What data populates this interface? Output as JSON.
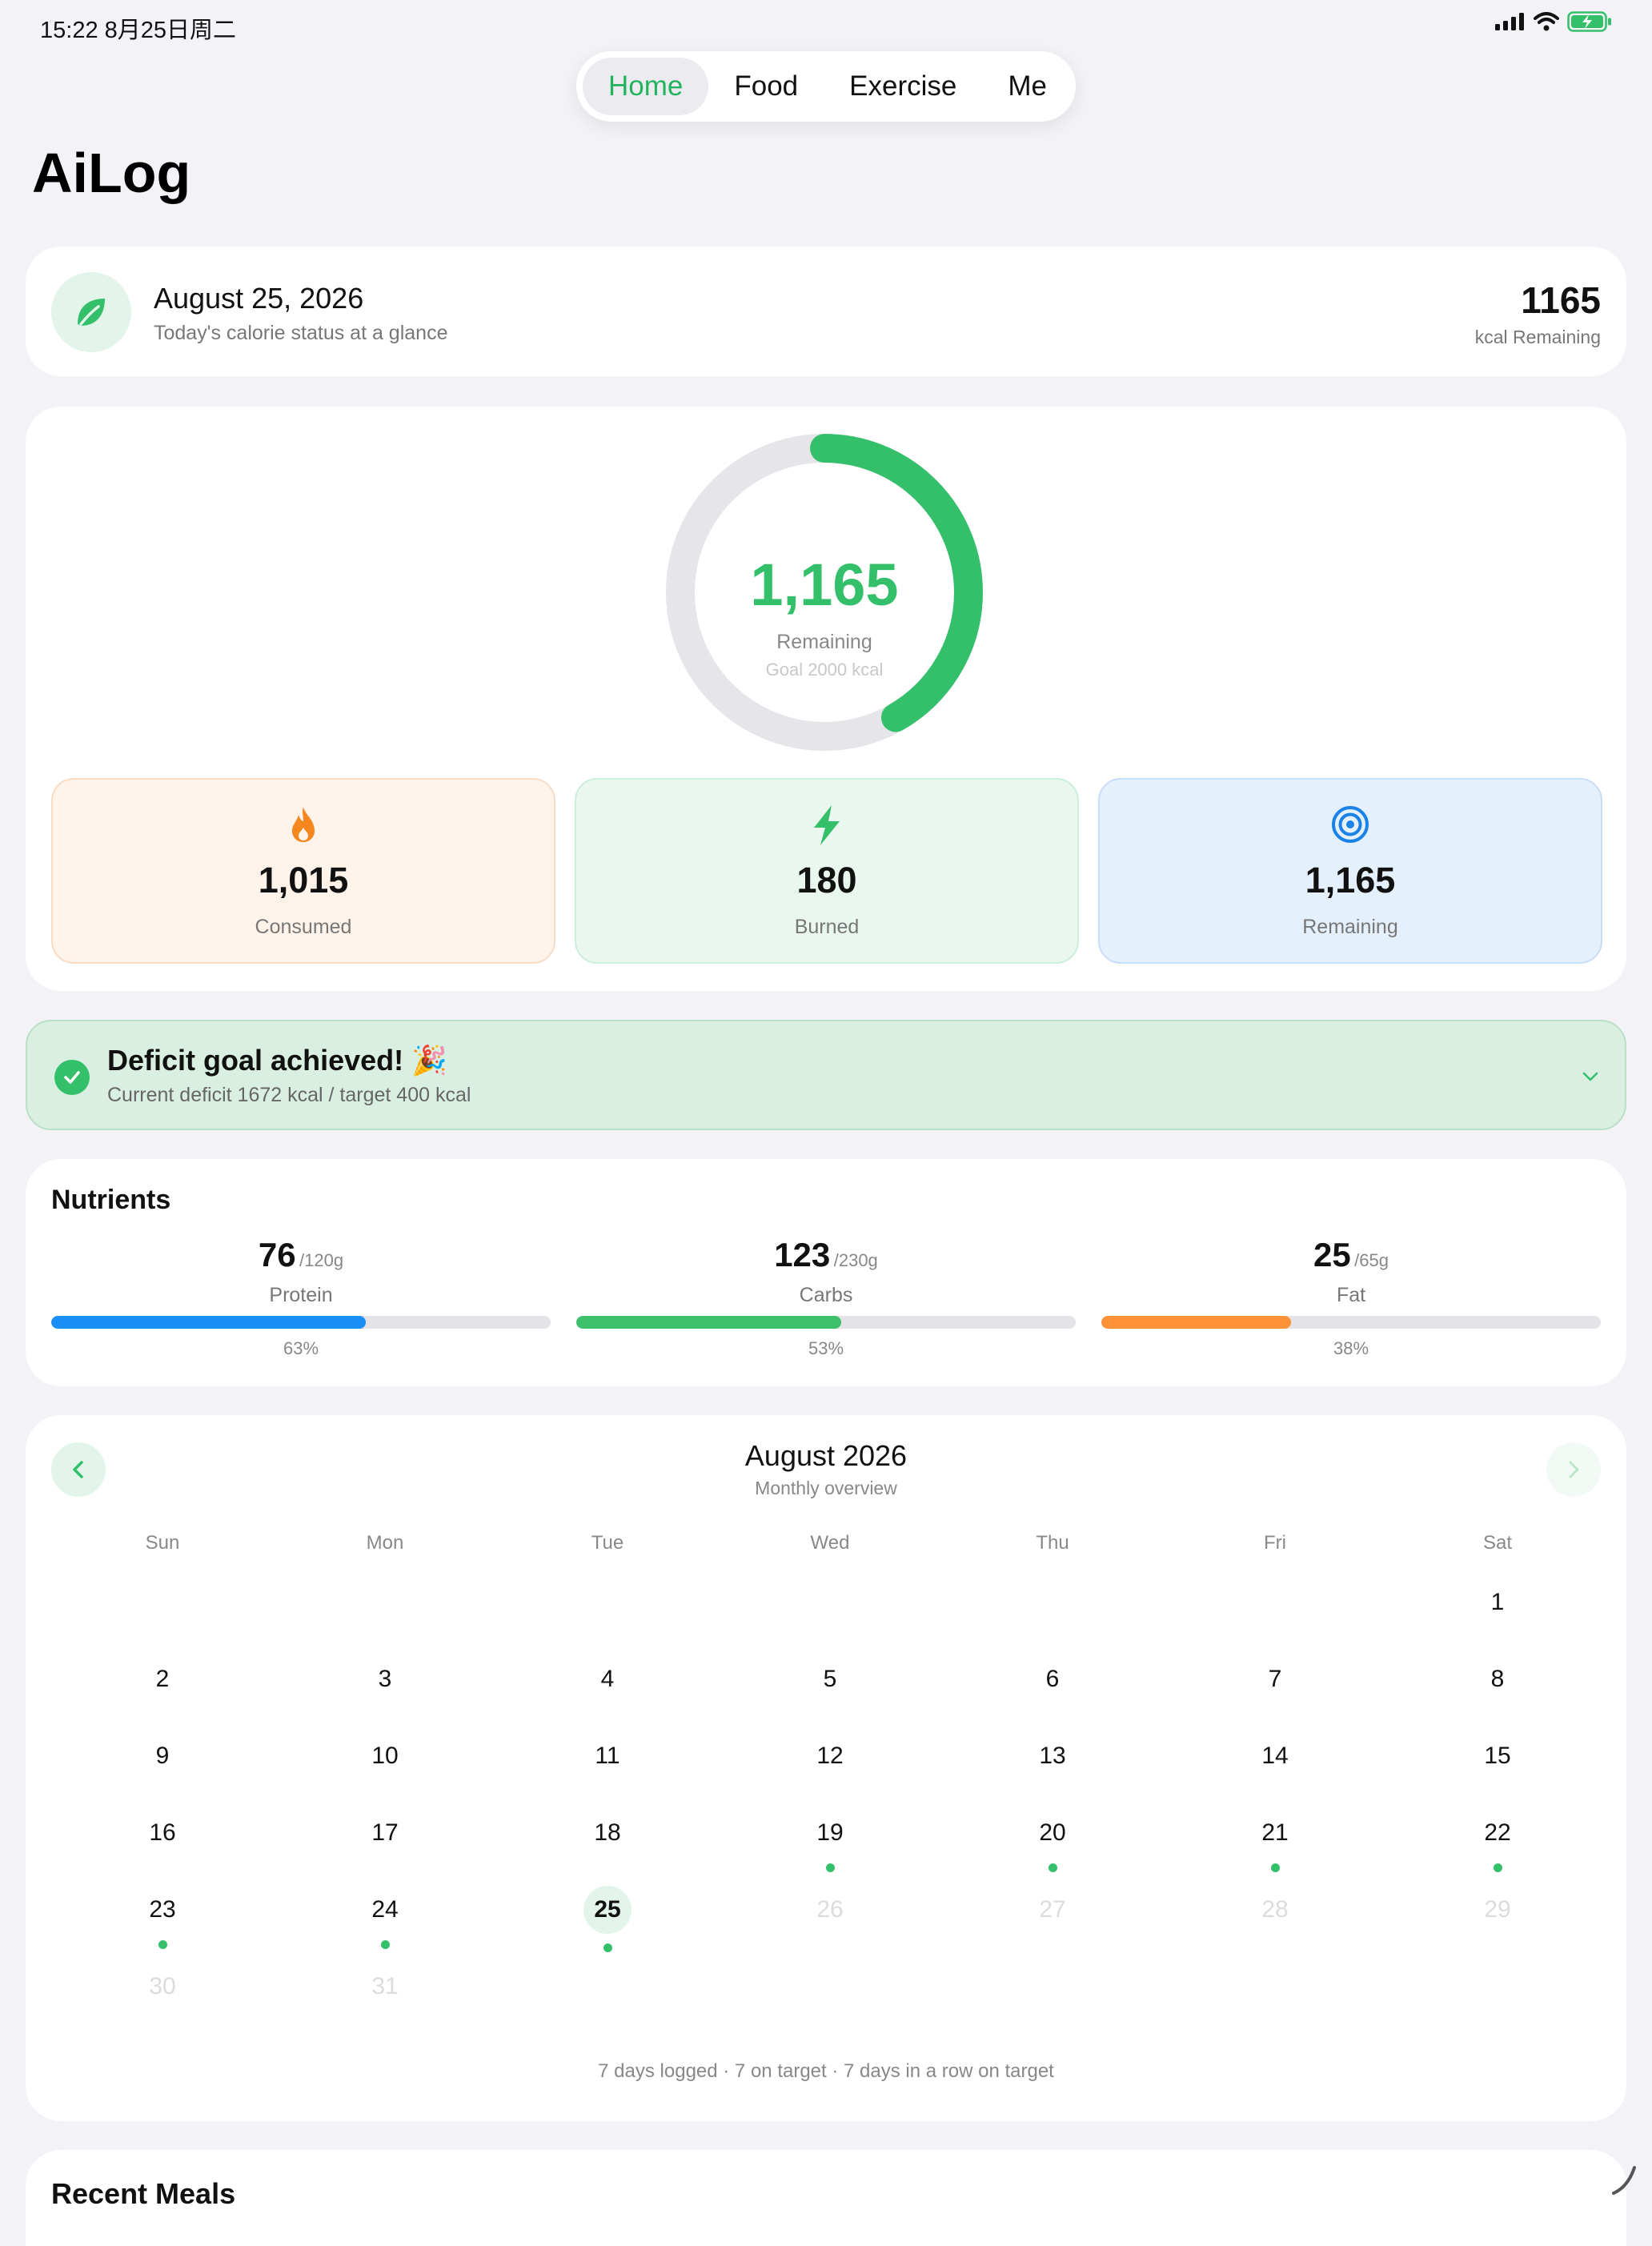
{
  "status_bar": {
    "time_date": "15:22  8月25日周二",
    "signal_icon": "cellular-signal-icon",
    "wifi_icon": "wifi-icon",
    "battery_icon": "battery-charging-icon"
  },
  "tabs": [
    {
      "label": "Home",
      "active": true
    },
    {
      "label": "Food",
      "active": false
    },
    {
      "label": "Exercise",
      "active": false
    },
    {
      "label": "Me",
      "active": false
    }
  ],
  "app_title": "AiLog",
  "date_card": {
    "icon": "leaf-icon",
    "date": "August 25, 2026",
    "subtitle": "Today's calorie status at a glance",
    "kcal_value": "1165",
    "kcal_label": "kcal Remaining"
  },
  "ring": {
    "value": "1,165",
    "label": "Remaining",
    "goal": "Goal 2000 kcal",
    "progress": 0.4175,
    "color": "#34c06a",
    "track_color": "#e5e5ea"
  },
  "stats": [
    {
      "icon": "flame-icon",
      "value": "1,015",
      "label": "Consumed",
      "color": "#f6871f"
    },
    {
      "icon": "lightning-icon",
      "value": "180",
      "label": "Burned",
      "color": "#34c06a"
    },
    {
      "icon": "target-icon",
      "value": "1,165",
      "label": "Remaining",
      "color": "#1b82e8"
    }
  ],
  "deficit": {
    "title": "Deficit goal achieved! 🎉",
    "subtitle": "Current deficit 1672 kcal / target 400 kcal",
    "icon": "check-circle-icon",
    "chevron": "chevron-down-icon"
  },
  "nutrients": {
    "heading": "Nutrients",
    "items": [
      {
        "value": "76",
        "target": "/120g",
        "name": "Protein",
        "percent": "63%",
        "progress": 0.63,
        "color": "#1a8ff5"
      },
      {
        "value": "123",
        "target": "/230g",
        "name": "Carbs",
        "percent": "53%",
        "progress": 0.53,
        "color": "#3cc06b"
      },
      {
        "value": "25",
        "target": "/65g",
        "name": "Fat",
        "percent": "38%",
        "progress": 0.38,
        "color": "#fd9336"
      }
    ]
  },
  "calendar": {
    "title": "August 2026",
    "subtitle": "Monthly overview",
    "prev_icon": "chevron-left-icon",
    "next_icon": "chevron-right-icon",
    "weekdays": [
      "Sun",
      "Mon",
      "Tue",
      "Wed",
      "Thu",
      "Fri",
      "Sat"
    ],
    "weeks": [
      [
        null,
        null,
        null,
        null,
        null,
        null,
        {
          "day": "1",
          "state": "normal",
          "dot": false
        }
      ],
      [
        {
          "day": "2",
          "state": "normal",
          "dot": false
        },
        {
          "day": "3",
          "state": "normal",
          "dot": false
        },
        {
          "day": "4",
          "state": "normal",
          "dot": false
        },
        {
          "day": "5",
          "state": "normal",
          "dot": false
        },
        {
          "day": "6",
          "state": "normal",
          "dot": false
        },
        {
          "day": "7",
          "state": "normal",
          "dot": false
        },
        {
          "day": "8",
          "state": "normal",
          "dot": false
        }
      ],
      [
        {
          "day": "9",
          "state": "normal",
          "dot": false
        },
        {
          "day": "10",
          "state": "normal",
          "dot": false
        },
        {
          "day": "11",
          "state": "normal",
          "dot": false
        },
        {
          "day": "12",
          "state": "normal",
          "dot": false
        },
        {
          "day": "13",
          "state": "normal",
          "dot": false
        },
        {
          "day": "14",
          "state": "normal",
          "dot": false
        },
        {
          "day": "15",
          "state": "normal",
          "dot": false
        }
      ],
      [
        {
          "day": "16",
          "state": "normal",
          "dot": false
        },
        {
          "day": "17",
          "state": "normal",
          "dot": false
        },
        {
          "day": "18",
          "state": "normal",
          "dot": false
        },
        {
          "day": "19",
          "state": "normal",
          "dot": true
        },
        {
          "day": "20",
          "state": "normal",
          "dot": true
        },
        {
          "day": "21",
          "state": "normal",
          "dot": true
        },
        {
          "day": "22",
          "state": "normal",
          "dot": true
        }
      ],
      [
        {
          "day": "23",
          "state": "normal",
          "dot": true
        },
        {
          "day": "24",
          "state": "normal",
          "dot": true
        },
        {
          "day": "25",
          "state": "today",
          "dot": true
        },
        {
          "day": "26",
          "state": "future",
          "dot": false
        },
        {
          "day": "27",
          "state": "future",
          "dot": false
        },
        {
          "day": "28",
          "state": "future",
          "dot": false
        },
        {
          "day": "29",
          "state": "future",
          "dot": false
        }
      ],
      [
        {
          "day": "30",
          "state": "future",
          "dot": false
        },
        {
          "day": "31",
          "state": "future",
          "dot": false
        },
        null,
        null,
        null,
        null,
        null
      ]
    ],
    "footer": "7 days logged · 7 on target · 7 days in a row on target"
  },
  "recent": {
    "title": "Recent Meals"
  },
  "colors": {
    "accent": "#34c06a",
    "background": "#f2f2f7"
  }
}
